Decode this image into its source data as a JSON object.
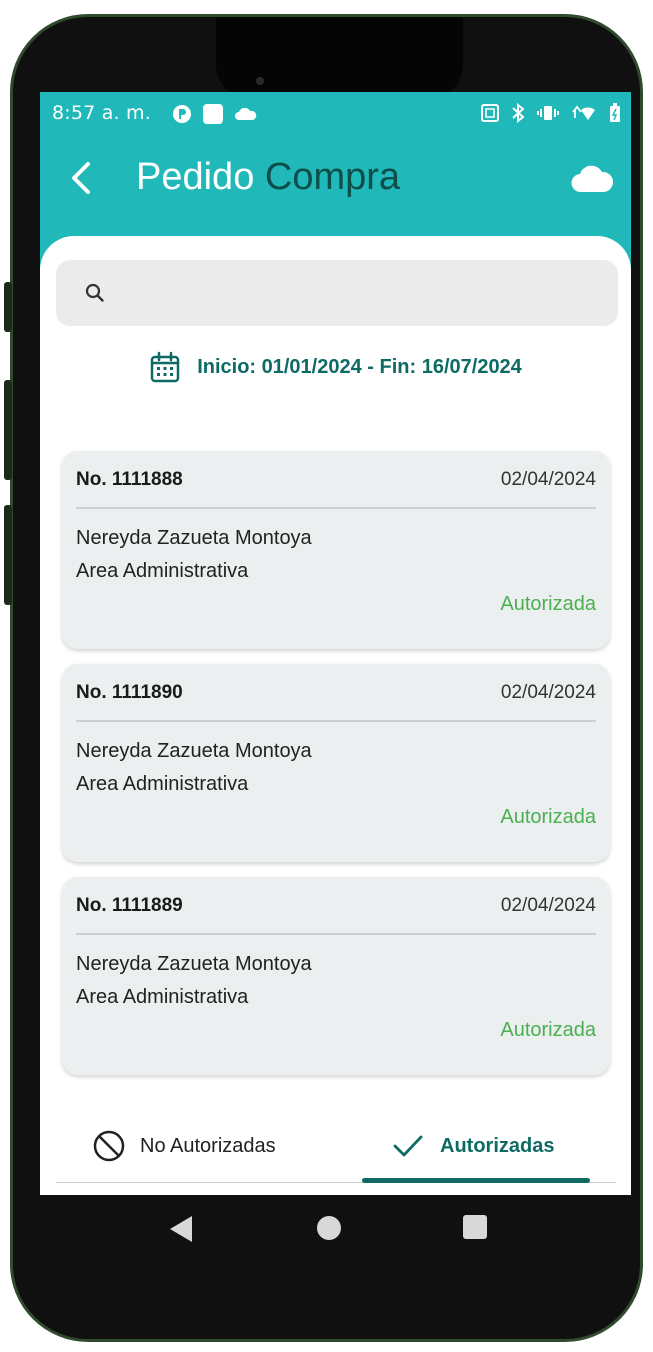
{
  "status_bar": {
    "time": "8:57 a. m."
  },
  "app_bar": {
    "title_part1": "Pedido",
    "title_part2": "Compra"
  },
  "search": {
    "placeholder": ""
  },
  "date_range": {
    "text": "Inicio: 01/01/2024 - Fin: 16/07/2024"
  },
  "orders": [
    {
      "number": "No. 1111888",
      "date": "02/04/2024",
      "name": "Nereyda Zazueta Montoya",
      "area": "Area Administrativa",
      "status": "Autorizada"
    },
    {
      "number": "No. 1111890",
      "date": "02/04/2024",
      "name": "Nereyda Zazueta Montoya",
      "area": "Area Administrativa",
      "status": "Autorizada"
    },
    {
      "number": "No. 1111889",
      "date": "02/04/2024",
      "name": "Nereyda Zazueta Montoya",
      "area": "Area Administrativa",
      "status": "Autorizada"
    }
  ],
  "tabs": {
    "not_authorized": "No Autorizadas",
    "authorized": "Autorizadas"
  },
  "colors": {
    "primary": "#20b8b8",
    "accent": "#0d6b64",
    "status_green": "#4caf50"
  }
}
